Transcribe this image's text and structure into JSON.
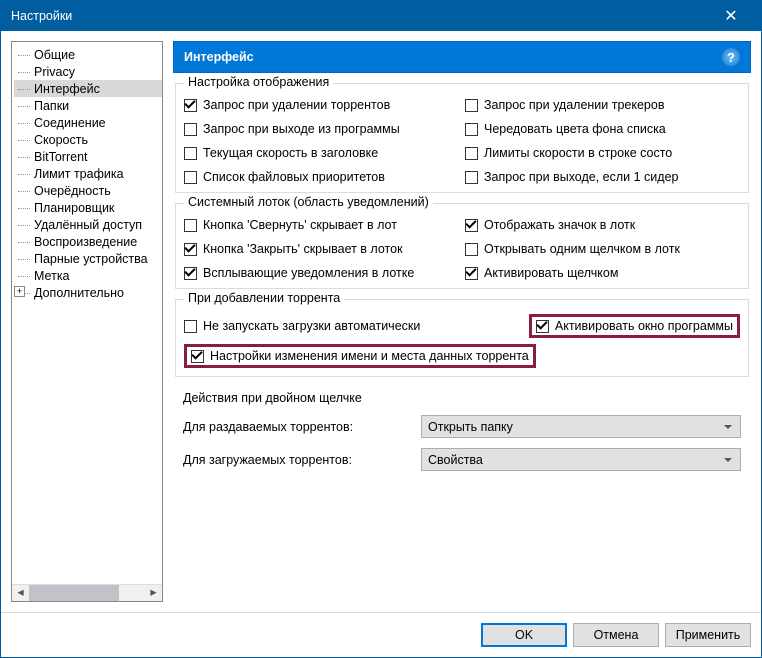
{
  "window": {
    "title": "Настройки"
  },
  "tree": {
    "items": [
      "Общие",
      "Privacy",
      "Интерфейс",
      "Папки",
      "Соединение",
      "Скорость",
      "BitTorrent",
      "Лимит трафика",
      "Очерёдность",
      "Планировщик",
      "Удалённый доступ",
      "Воспроизведение",
      "Парные устройства",
      "Метка",
      "Дополнительно"
    ],
    "selected_index": 2,
    "expandable_index": 14
  },
  "header": {
    "title": "Интерфейс",
    "help": "?"
  },
  "groups": {
    "display": {
      "title": "Настройка отображения",
      "left": [
        {
          "label": "Запрос при удалении торрентов",
          "checked": true
        },
        {
          "label": "Запрос при выходе из программы",
          "checked": false
        },
        {
          "label": "Текущая скорость в заголовке",
          "checked": false
        },
        {
          "label": "Список файловых приоритетов",
          "checked": false
        }
      ],
      "right": [
        {
          "label": "Запрос при удалении трекеров",
          "checked": false
        },
        {
          "label": "Чередовать цвета фона списка",
          "checked": false
        },
        {
          "label": "Лимиты скорости в строке состо",
          "checked": false
        },
        {
          "label": "Запрос при выходе, если 1 сидер",
          "checked": false
        }
      ]
    },
    "tray": {
      "title": "Системный лоток (область уведомлений)",
      "left": [
        {
          "label": "Кнопка 'Свернуть' скрывает в лот",
          "checked": false
        },
        {
          "label": "Кнопка 'Закрыть' скрывает в лоток",
          "checked": true
        },
        {
          "label": "Всплывающие уведомления в лотке",
          "checked": true
        }
      ],
      "right": [
        {
          "label": "Отображать значок в лотк",
          "checked": true
        },
        {
          "label": "Открывать одним щелчком в лотк",
          "checked": false
        },
        {
          "label": "Активировать щелчком",
          "checked": true
        }
      ]
    },
    "add": {
      "title": "При добавлении торрента",
      "row1_left": {
        "label": "Не запускать загрузки автоматически",
        "checked": false
      },
      "row1_right": {
        "label": "Активировать окно программы",
        "checked": true
      },
      "row2": {
        "label": "Настройки изменения имени и места данных торрента",
        "checked": true
      }
    },
    "dblclick": {
      "title": "Действия при двойном щелчке",
      "rows": [
        {
          "label": "Для раздаваемых торрентов:",
          "value": "Открыть папку"
        },
        {
          "label": "Для загружаемых торрентов:",
          "value": "Свойства"
        }
      ]
    }
  },
  "footer": {
    "ok": "OK",
    "cancel": "Отмена",
    "apply": "Применить"
  }
}
